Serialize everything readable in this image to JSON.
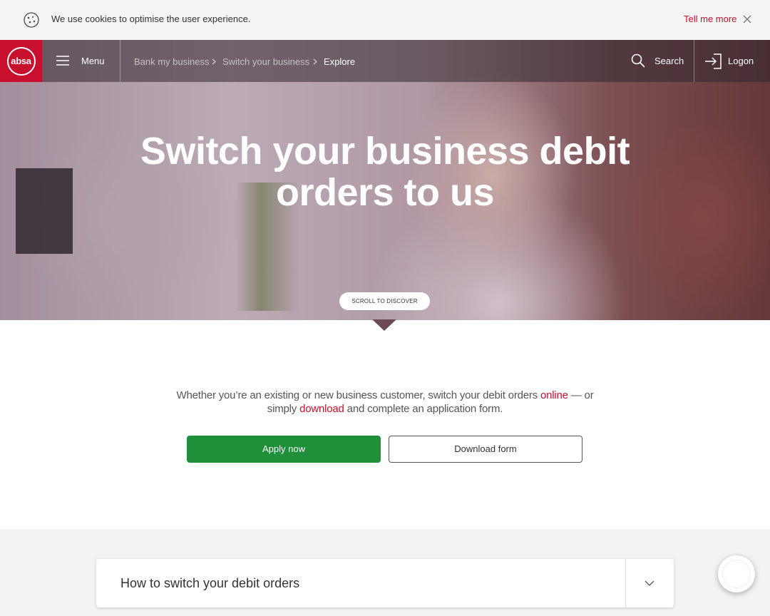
{
  "cookie_bar": {
    "message": "We use cookies to optimise the user experience.",
    "link_label": "Tell me more",
    "icons": {
      "cookie": "cookie-icon",
      "close": "close-icon"
    }
  },
  "nav": {
    "logo_text": "absa",
    "menu_label": "Menu",
    "breadcrumbs": [
      {
        "label": "Bank my business"
      },
      {
        "label": "Switch your business"
      },
      {
        "label": "Explore"
      }
    ],
    "search_label": "Search",
    "logon_label": "Logon"
  },
  "hero": {
    "title_line1": "Switch your business debit",
    "title_line2": "orders to us",
    "scroll_label": "SCROLL TO DISCOVER"
  },
  "intro": {
    "part1": "Whether you’re an existing or new business customer, switch your debit orders ",
    "link_online": "online",
    "part2": " — or simply ",
    "link_download": "download",
    "part3": " and complete an application form."
  },
  "actions": {
    "apply_label": "Apply now",
    "download_label": "Download form"
  },
  "accordion": {
    "title": "How to switch your debit orders"
  },
  "colors": {
    "brand_red": "#c8102e",
    "apply_green": "#1f8f3a"
  }
}
